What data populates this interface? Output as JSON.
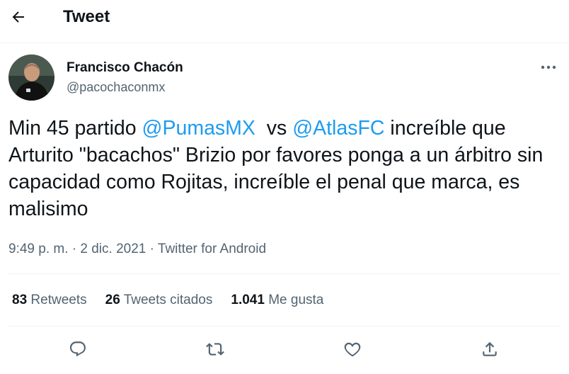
{
  "header": {
    "back_icon": "arrow-left-icon",
    "title": "Tweet"
  },
  "author": {
    "name": "Francisco Chacón",
    "handle": "@pacochaconmx",
    "avatar_icon": "user-avatar"
  },
  "tweet": {
    "segments": [
      {
        "text": "Min 45 partido ",
        "mention": false
      },
      {
        "text": "@PumasMX",
        "mention": true
      },
      {
        "text": "  vs ",
        "mention": false
      },
      {
        "text": "@AtlasFC",
        "mention": true
      },
      {
        "text": " increíble que Arturito \"bacachos\" Brizio por favores ponga a un árbitro sin capacidad como Rojitas, increíble el penal que marca, es malisimo",
        "mention": false
      }
    ],
    "time": "9:49 p. m.",
    "separator": "·",
    "date": "2 dic. 2021",
    "source": "Twitter for Android"
  },
  "stats": {
    "retweets_count": "83",
    "retweets_label": "Retweets",
    "quotes_count": "26",
    "quotes_label": "Tweets citados",
    "likes_count": "1.041",
    "likes_label": "Me gusta"
  },
  "actions": {
    "reply_icon": "reply-icon",
    "retweet_icon": "retweet-icon",
    "like_icon": "heart-icon",
    "share_icon": "share-icon"
  },
  "colors": {
    "accent": "#1d9bf0",
    "text": "#0f1419",
    "secondary": "#536471",
    "divider": "#eff3f4"
  }
}
